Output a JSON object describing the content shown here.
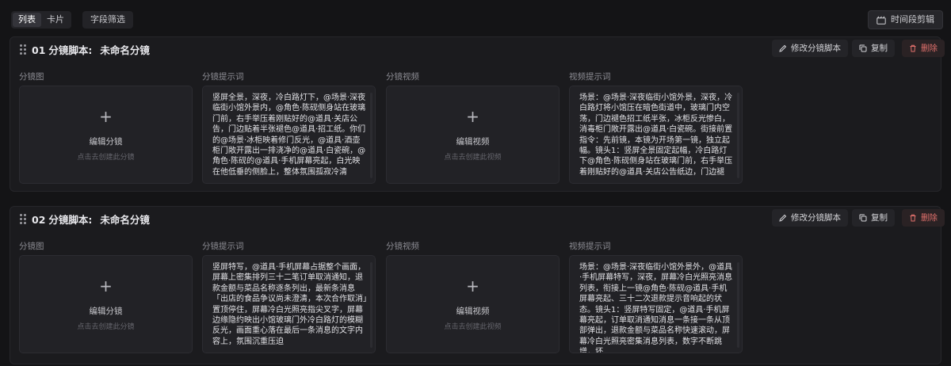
{
  "toolbar": {
    "view_list": "列表",
    "view_card": "卡片",
    "field_filter": "字段筛选",
    "timeline_edit": "时间段剪辑"
  },
  "columns": {
    "storyboard_image": "分镜图",
    "storyboard_prompt": "分镜提示词",
    "storyboard_video": "分镜视频",
    "video_prompt": "视频提示词"
  },
  "actions": {
    "edit_script": "修改分镜脚本",
    "copy": "复制",
    "delete": "删除"
  },
  "empty_panels": {
    "edit_image": "编辑分镜",
    "image_hint": "点击去创建此分镜",
    "edit_video": "编辑视频",
    "video_hint": "点击去创建此视频"
  },
  "scenes": [
    {
      "number": "01",
      "script_label": "分镜脚本:",
      "name": "未命名分镜",
      "storyboard_prompt": "竖屏全景，深夜，冷白路灯下，@场景·深夜临街小馆外景内，@角色·陈砚侧身站在玻璃门前，右手举压着刚贴好的@道具·关店公告，门边贴着半张褪色@道具·招工纸。你们的@场景·冰柜映着修门反光，@道具·酒壶柜门敞开露出一排浇净的@道具·白瓷碗，@角色·陈砚的@道具·手机屏幕亮起，白光映在他低垂的侧脸上，整体氛围孤寂冷清",
      "video_prompt": "场景：@场景·深夜临街小馆外景，深夜，冷白路灯将小馆压在暗色街道中，玻璃门内空荡，门边褪色招工纸半张，冰柜反光惨白，消毒柜门敞开露出@道具·白瓷碗。街接前置指令：先前镜，本镜为开场第一镜，独立起幅。镜头1：竖屏全景固定起幅，冷白路灯下@角色·陈砚侧身站在玻璃门前，右手举压着刚贴好的@道具·关店公告纸边，门边褪"
    },
    {
      "number": "02",
      "script_label": "分镜脚本:",
      "name": "未命名分镜",
      "storyboard_prompt": "竖屏特写，@道具·手机屏幕占据整个画面，屏幕上密集排列三十二笔订单取消通知，退款金额与菜品名称逐条列出，最新条消息「出店的食品争议尚未澄清，本次合作取消」置顶停住，屏幕冷白光照亮指尖叉字，屏幕边缘隐约映出小馆玻璃门外冷白路灯的模糊反光，画面重心落在最后一条消息的文字内容上，氛围沉重压迫",
      "video_prompt": "场景：@场景·深夜临街小馆外景外，@道具·手机屏幕特写，深夜，屏幕冷白光照亮消息列表，衔接上一镜@角色·陈砚@道具·手机屏幕亮起、三十二次退款提示音响起的状态。镜头1：竖屏特写固定，@道具·手机屏幕亮起，订单取消通知消息一条接一条从顶部弹出，退款金额与菜品名称快速滚动，屏幕冷白光照亮密集消息列表，数字不断跳增，坏"
    }
  ]
}
